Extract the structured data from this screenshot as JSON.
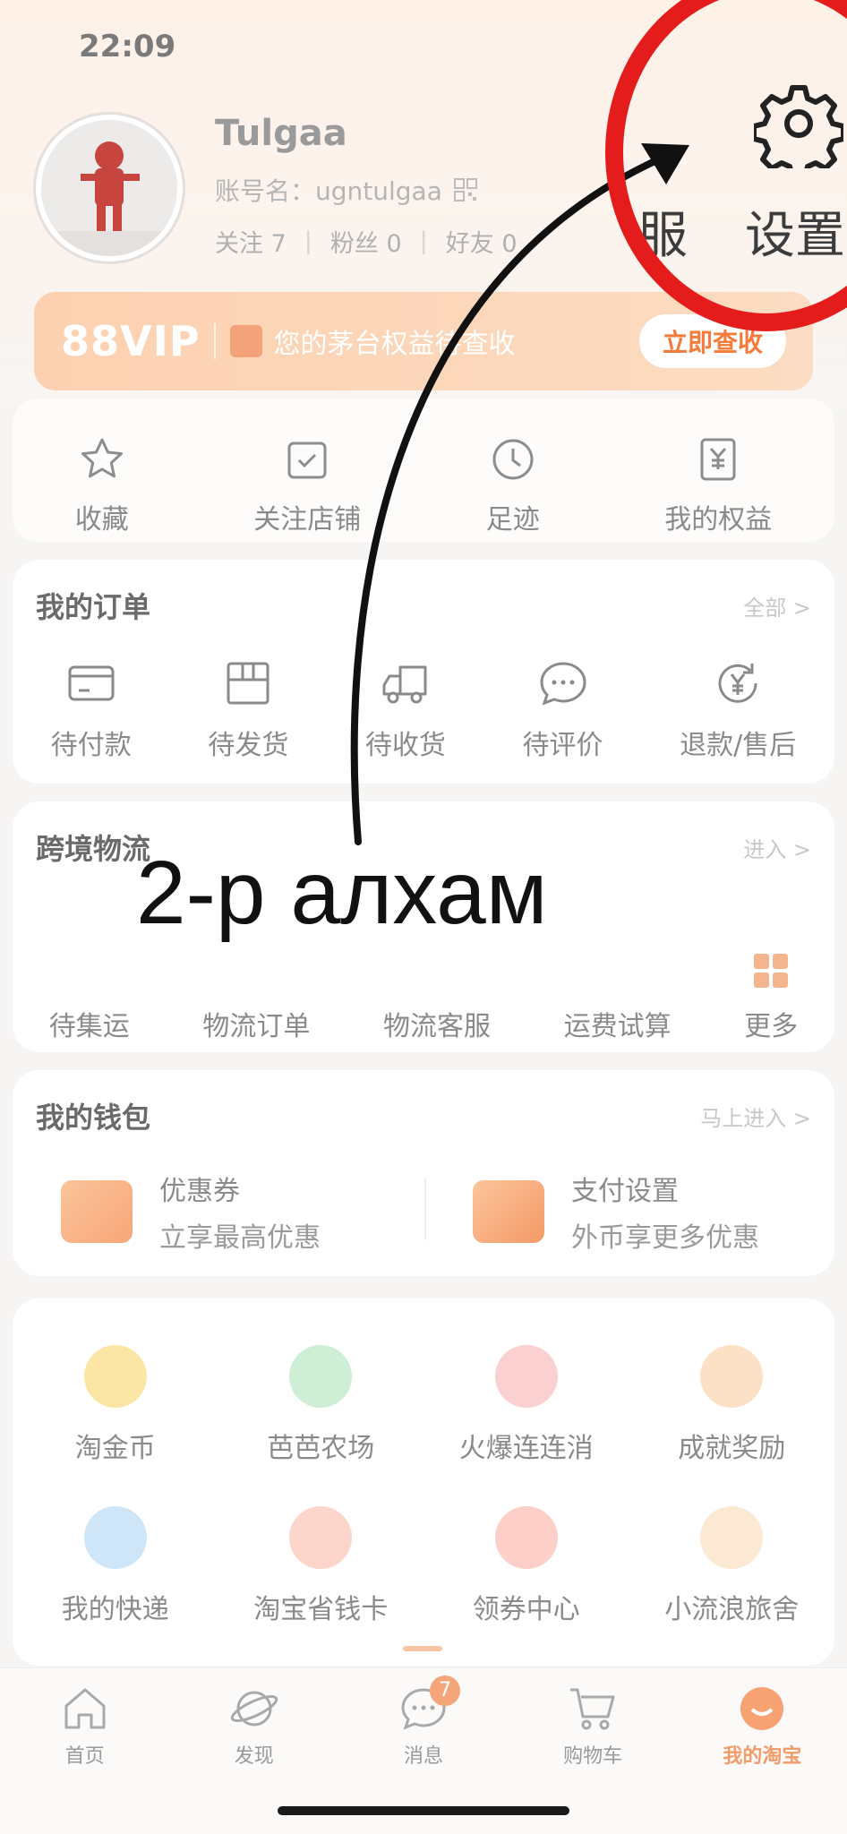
{
  "status_bar": {
    "time": "22:09"
  },
  "profile": {
    "name": "Tulgaa",
    "account_label": "账号名：ugntulgaa",
    "stats": [
      {
        "label": "关注 7"
      },
      {
        "label": "粉丝 0"
      },
      {
        "label": "好友 0"
      }
    ]
  },
  "top_actions": {
    "service_label": "服",
    "settings_label": "设置"
  },
  "vip": {
    "brand": "88VIP",
    "promo": "您的茅台权益待查收",
    "button": "立即查收"
  },
  "quick_links": [
    {
      "label": "收藏",
      "icon": "star-icon"
    },
    {
      "label": "关注店铺",
      "icon": "check-shop-icon"
    },
    {
      "label": "足迹",
      "icon": "clock-icon"
    },
    {
      "label": "我的权益",
      "icon": "voucher-icon"
    }
  ],
  "orders": {
    "title": "我的订单",
    "more": "全部 >",
    "items": [
      {
        "label": "待付款",
        "icon": "wallet-icon"
      },
      {
        "label": "待发货",
        "icon": "box-icon"
      },
      {
        "label": "待收货",
        "icon": "truck-icon"
      },
      {
        "label": "待评价",
        "icon": "chat-icon"
      },
      {
        "label": "退款/售后",
        "icon": "refund-icon"
      }
    ]
  },
  "logistics": {
    "title": "跨境物流",
    "more": "进入 >",
    "items": [
      {
        "label": "待集运"
      },
      {
        "label": "物流订单"
      },
      {
        "label": "物流客服"
      },
      {
        "label": "运费试算"
      },
      {
        "label": "更多",
        "icon": "grid-icon"
      }
    ]
  },
  "wallet": {
    "title": "我的钱包",
    "more": "马上进入 >",
    "items": [
      {
        "name": "优惠券",
        "desc": "立享最高优惠",
        "icon": "coupon-icon"
      },
      {
        "name": "支付设置",
        "desc": "外币享更多优惠",
        "icon": "card-settings-icon"
      }
    ]
  },
  "games": [
    {
      "label": "淘金币",
      "icon": "coin-icon",
      "color": "#fbe6a6"
    },
    {
      "label": "芭芭农场",
      "icon": "tree-icon",
      "color": "#cfeed6"
    },
    {
      "label": "火爆连连消",
      "icon": "puzzle-icon",
      "color": "#fbd0d0"
    },
    {
      "label": "成就奖励",
      "icon": "trophy-icon",
      "color": "#fde1c6"
    },
    {
      "label": "我的快递",
      "icon": "parcel-icon",
      "color": "#cfe6f8"
    },
    {
      "label": "淘宝省钱卡",
      "icon": "card-icon",
      "color": "#fcd6cb"
    },
    {
      "label": "领券中心",
      "icon": "ticket-icon",
      "color": "#fcd0c8"
    },
    {
      "label": "小流浪旅舍",
      "icon": "paw-icon",
      "color": "#fbe9d3"
    }
  ],
  "tabbar": [
    {
      "label": "首页",
      "icon": "home-icon"
    },
    {
      "label": "发现",
      "icon": "planet-icon"
    },
    {
      "label": "消息",
      "icon": "message-icon",
      "badge": "7"
    },
    {
      "label": "购物车",
      "icon": "cart-icon"
    },
    {
      "label": "我的淘宝",
      "icon": "my-taobao-icon",
      "active": true
    }
  ],
  "annotation": {
    "text": "2-р алхам"
  },
  "colors": {
    "accent": "#f39c6b",
    "annotation_circle": "#e51c1c"
  }
}
